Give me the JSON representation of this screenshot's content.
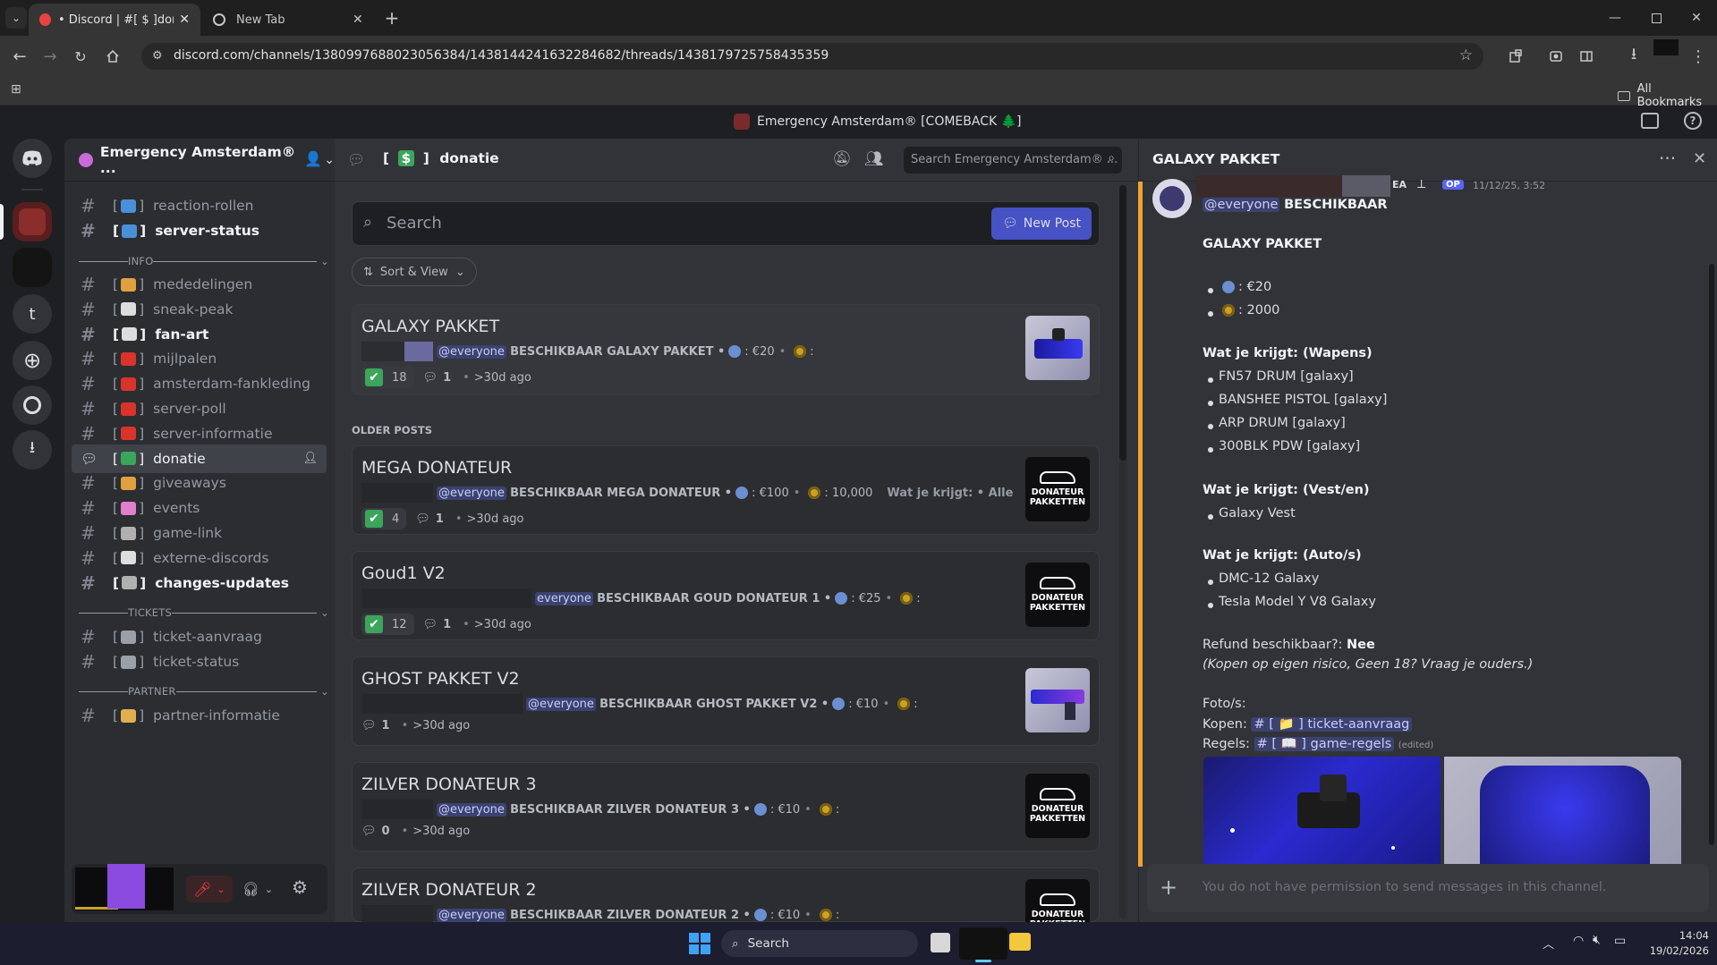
{
  "browser": {
    "tabs": [
      {
        "title": "• Discord | #[ $ ]donatie | Eme",
        "active": true,
        "icon": "discord-tab-icon"
      },
      {
        "title": "New Tab",
        "active": false,
        "icon": "chrome-tab-icon"
      }
    ],
    "url": "discord.com/channels/1380997688023056384/1438144241632284682/threads/1438179725758435359",
    "bookmarks_label": "All Bookmarks"
  },
  "discord": {
    "server_title_bar": "Emergency Amsterdam® [COMEBACK 🌲]",
    "server_name": "Emergency Amsterdam® ...",
    "channels_top": [
      {
        "name": "reaction-rollen",
        "unread": false,
        "icon": "keycap-icon",
        "color": "#4a90d9"
      },
      {
        "name": "server-status",
        "unread": true,
        "icon": "keycap-icon",
        "color": "#4a90d9"
      }
    ],
    "category_info": "INFO",
    "channels_info": [
      {
        "name": "mededelingen",
        "unread": false,
        "icon": "megaphone-icon",
        "color": "#e0a040"
      },
      {
        "name": "sneak-peak",
        "unread": false,
        "icon": "eyes-icon",
        "color": "#dddddd"
      },
      {
        "name": "fan-art",
        "unread": true,
        "icon": "eyes-icon",
        "color": "#dddddd"
      },
      {
        "name": "mijlpalen",
        "unread": false,
        "icon": "hundred-icon",
        "color": "#d9342b"
      },
      {
        "name": "amsterdam-fankleding",
        "unread": false,
        "icon": "hundred-icon",
        "color": "#d9342b"
      },
      {
        "name": "server-poll",
        "unread": false,
        "icon": "ballot-icon",
        "color": "#d9342b"
      },
      {
        "name": "server-informatie",
        "unread": false,
        "icon": "ballot-icon",
        "color": "#d9342b"
      },
      {
        "name": "donatie",
        "unread": false,
        "selected": true,
        "icon": "dollar-icon",
        "color": "#3ba55c"
      },
      {
        "name": "giveaways",
        "unread": false,
        "icon": "moneybag-icon",
        "color": "#e0a040"
      },
      {
        "name": "events",
        "unread": false,
        "icon": "party-icon",
        "color": "#e07fd0"
      },
      {
        "name": "game-link",
        "unread": false,
        "icon": "link-icon",
        "color": "#b0b0b0"
      },
      {
        "name": "externe-discords",
        "unread": false,
        "icon": "clipboard-icon",
        "color": "#dddddd"
      },
      {
        "name": "changes-updates",
        "unread": true,
        "icon": "tools-icon",
        "color": "#b0b0b0"
      }
    ],
    "category_tickets": "TICKETS",
    "channels_tickets": [
      {
        "name": "ticket-aanvraag",
        "icon": "folder-icon",
        "color": "#9aa0a8"
      },
      {
        "name": "ticket-status",
        "icon": "folder-icon",
        "color": "#9aa0a8"
      }
    ],
    "category_partner": "PARTNER",
    "channels_partner": [
      {
        "name": "partner-informatie",
        "icon": "handshake-icon",
        "color": "#e0b050"
      }
    ]
  },
  "forum": {
    "channel_bracket_open": "[",
    "channel_symbol": "$",
    "channel_bracket_close": "]",
    "channel_name": "donatie",
    "search_header_placeholder": "Search Emergency Amsterdam® ...",
    "search_placeholder": "Search",
    "new_post_label": "New Post",
    "sort_label": "Sort & View",
    "older_posts_label": "OLDER POSTS",
    "posts": [
      {
        "title": "GALAXY PAKKET",
        "mention": "@everyone",
        "preview": "BESCHIKBAAR GALAXY PAKKET •",
        "price": ": €20",
        "coins": ":",
        "reactions": "18",
        "replies": "1",
        "age": ">30d ago",
        "thumb": "galaxy-gun-thumbnail"
      },
      {
        "title": "MEGA DONATEUR",
        "mention": "@everyone",
        "preview": "BESCHIKBAAR MEGA DONATEUR •",
        "price": ": €100",
        "coins": ": 10,000",
        "extra": "Wat je krijgt: • Alle",
        "reactions": "4",
        "replies": "1",
        "age": ">30d ago",
        "thumb": "donateur-pakketten-thumbnail"
      },
      {
        "title": "Goud1 V2",
        "mention": "everyone",
        "preview": "BESCHIKBAAR GOUD DONATEUR 1 •",
        "price": ": €25",
        "coins": ":",
        "reactions": "12",
        "replies": "1",
        "age": ">30d ago",
        "thumb": "donateur-pakketten-thumbnail"
      },
      {
        "title": "GHOST PAKKET V2",
        "mention": "@everyone",
        "preview": "BESCHIKBAAR GHOST PAKKET V2 •",
        "price": ": €10",
        "coins": ":",
        "replies": "1",
        "age": ">30d ago",
        "thumb": "ghost-gun-thumbnail"
      },
      {
        "title": "ZILVER DONATEUR 3",
        "mention": "@everyone",
        "preview": "BESCHIKBAAR ZILVER DONATEUR 3 •",
        "price": ": €10",
        "coins": ":",
        "replies": "0",
        "age": ">30d ago",
        "thumb": "donateur-pakketten-thumbnail"
      },
      {
        "title": "ZILVER DONATEUR 2",
        "mention": "@everyone",
        "preview": "BESCHIKBAAR ZILVER DONATEUR 2 •",
        "price": ": €10",
        "coins": ":",
        "thumb": "donateur-pakketten-thumbnail"
      }
    ],
    "donateur_thumb_line1": "DONATEUR",
    "donateur_thumb_line2": "PAKKETTEN"
  },
  "thread": {
    "title": "GALAXY PAKKET",
    "badge_ea": "EA",
    "badge_op": "OP",
    "timestamp": "11/12/25, 3:52",
    "mention": "@everyone",
    "headline": "BESCHIKBAAR",
    "package": "GALAXY PAKKET",
    "price_eur": ": €20",
    "price_coins": ": 2000",
    "weapons_heading": "Wat je krijgt: (Wapens)",
    "weapons": [
      "FN57 DRUM [galaxy]",
      "BANSHEE PISTOL [galaxy]",
      "ARP DRUM [galaxy]",
      "300BLK PDW [galaxy]"
    ],
    "vest_heading": "Wat je krijgt: (Vest/en)",
    "vests": [
      "Galaxy Vest"
    ],
    "cars_heading": "Wat je krijgt: (Auto/s)",
    "cars": [
      "DMC-12 Galaxy",
      "Tesla Model Y V8 Galaxy"
    ],
    "refund_label": "Refund beschikbaar?:",
    "refund_value": "Nee",
    "disclaimer": "(Kopen op eigen risico, Geen 18? Vraag je ouders.)",
    "photos_label": "Foto/s:",
    "buy_label": "Kopen:",
    "buy_channel": "[ 📁 ] ticket-aanvraag",
    "rules_label": "Regels:",
    "rules_channel": "[ 📖 ] game-regels",
    "edited": "(edited)",
    "composer_placeholder": "You do not have permission to send messages in this channel."
  },
  "taskbar": {
    "search_label": "Search",
    "time": "14:04",
    "date": "19/02/2026"
  }
}
